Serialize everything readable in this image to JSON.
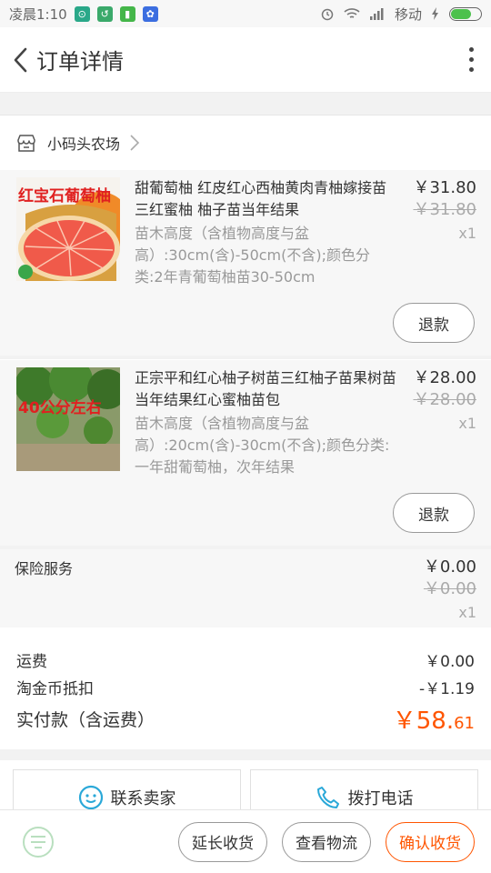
{
  "status_bar": {
    "time": "凌晨1:10",
    "carrier": "移动"
  },
  "header": {
    "title": "订单详情"
  },
  "shop": {
    "name": "小码头农场"
  },
  "items": [
    {
      "title": "甜葡萄柚 红皮红心西柚黄肉青柚嫁接苗 三红蜜柚 柚子苗当年结果",
      "spec": "苗木高度（含植物高度与盆高）:30cm(含)-50cm(不含);颜色分类:2年青葡萄柚苗30-50cm",
      "price": "￥31.80",
      "original_price": "￥31.80",
      "quantity": "x1",
      "refund_label": "退款",
      "thumb_caption": "红宝石葡萄柚"
    },
    {
      "title": "正宗平和红心柚子树苗三红柚子苗果树苗当年结果红心蜜柚苗包",
      "spec": "苗木高度（含植物高度与盆高）:20cm(含)-30cm(不含);颜色分类:一年甜葡萄柚，次年结果",
      "price": "￥28.00",
      "original_price": "￥28.00",
      "quantity": "x1",
      "refund_label": "退款",
      "thumb_caption": "40公分左右"
    }
  ],
  "insurance": {
    "label": "保险服务",
    "price": "￥0.00",
    "original_price": "￥0.00",
    "quantity": "x1"
  },
  "summary": {
    "shipping_label": "运费",
    "shipping_value": "￥0.00",
    "coin_label": "淘金币抵扣",
    "coin_value": "-￥1.19",
    "total_label": "实付款（含运费）",
    "total_big": "￥58.",
    "total_small": "61"
  },
  "contact": {
    "seller_label": "联系卖家",
    "phone_label": "拨打电话"
  },
  "actions": {
    "extend_label": "延长收货",
    "logistics_label": "查看物流",
    "confirm_label": "确认收货"
  },
  "colors": {
    "accent": "#ff5500",
    "contact_icon": "#2aa8d8"
  }
}
